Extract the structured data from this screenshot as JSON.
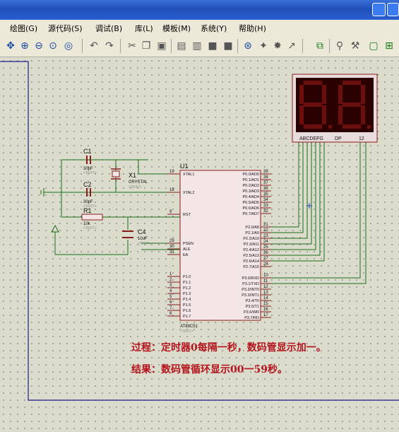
{
  "menu": [
    "绘图(G)",
    "源代码(S)",
    "调试(B)",
    "库(L)",
    "模板(M)",
    "系统(Y)",
    "帮助(H)"
  ],
  "components": {
    "c1": {
      "ref": "C1",
      "value": "30pF",
      "text": "<TEXT>"
    },
    "c2": {
      "ref": "C2",
      "value": "30pF",
      "text": "<TEXT>"
    },
    "x1": {
      "ref": "X1",
      "value": "CRYSTAL",
      "text": "<TEXT>"
    },
    "r1": {
      "ref": "R1",
      "value": "10k",
      "text": "<TEXT>"
    },
    "c4": {
      "ref": "C4",
      "value": "10uF",
      "text": "<TEXT>"
    },
    "u1": {
      "ref": "U1",
      "part": "AT89C51",
      "text": "<TEXT>"
    }
  },
  "mcu_left_pins": [
    {
      "num": "19",
      "name": "XTAL1"
    },
    {
      "num": "18",
      "name": "XTAL2"
    },
    {
      "num": "9",
      "name": "RST"
    },
    {
      "num": "29",
      "name": "PSEN"
    },
    {
      "num": "30",
      "name": "ALE"
    },
    {
      "num": "31",
      "name": "EA"
    },
    {
      "num": "1",
      "name": "P1.0"
    },
    {
      "num": "2",
      "name": "P1.1"
    },
    {
      "num": "3",
      "name": "P1.2"
    },
    {
      "num": "4",
      "name": "P1.3"
    },
    {
      "num": "5",
      "name": "P1.4"
    },
    {
      "num": "6",
      "name": "P1.5"
    },
    {
      "num": "7",
      "name": "P1.6"
    },
    {
      "num": "8",
      "name": "P1.7"
    }
  ],
  "mcu_right_pins": [
    {
      "num": "39",
      "name": "P0.0/AD0"
    },
    {
      "num": "38",
      "name": "P0.1/AD1"
    },
    {
      "num": "37",
      "name": "P0.2/AD2"
    },
    {
      "num": "36",
      "name": "P0.3/AD3"
    },
    {
      "num": "35",
      "name": "P0.4/AD4"
    },
    {
      "num": "34",
      "name": "P0.5/AD5"
    },
    {
      "num": "33",
      "name": "P0.6/AD6"
    },
    {
      "num": "32",
      "name": "P0.7/AD7"
    },
    {
      "num": "21",
      "name": "P2.0/A8"
    },
    {
      "num": "22",
      "name": "P2.1/A9"
    },
    {
      "num": "23",
      "name": "P2.2/A10"
    },
    {
      "num": "24",
      "name": "P2.3/A11"
    },
    {
      "num": "25",
      "name": "P2.4/A12"
    },
    {
      "num": "26",
      "name": "P2.5/A13"
    },
    {
      "num": "27",
      "name": "P2.6/A14"
    },
    {
      "num": "28",
      "name": "P2.7/A15"
    },
    {
      "num": "10",
      "name": "P3.0/RXD"
    },
    {
      "num": "11",
      "name": "P3.1/TXD"
    },
    {
      "num": "12",
      "name": "P3.2/INT0"
    },
    {
      "num": "13",
      "name": "P3.3/INT1"
    },
    {
      "num": "14",
      "name": "P3.4/T0"
    },
    {
      "num": "15",
      "name": "P3.5/T1"
    },
    {
      "num": "16",
      "name": "P3.6/WR"
    },
    {
      "num": "17",
      "name": "P3.7/RD"
    }
  ],
  "display": {
    "segments_label": "ABCDEFG",
    "dp_label": "DP",
    "common_label": "12"
  },
  "notes": {
    "process": "过程：定时器0每隔一秒，数码管显示加一。",
    "result": "结果：数码管循环显示00一59秒。"
  },
  "colors": {
    "wire": "#1a6e1a",
    "body_fill": "#f4e6e6",
    "body_stroke": "#8a1c1c",
    "note": "#b4141e",
    "segment": "#6a0e0e",
    "display_bg": "#2a0000"
  }
}
